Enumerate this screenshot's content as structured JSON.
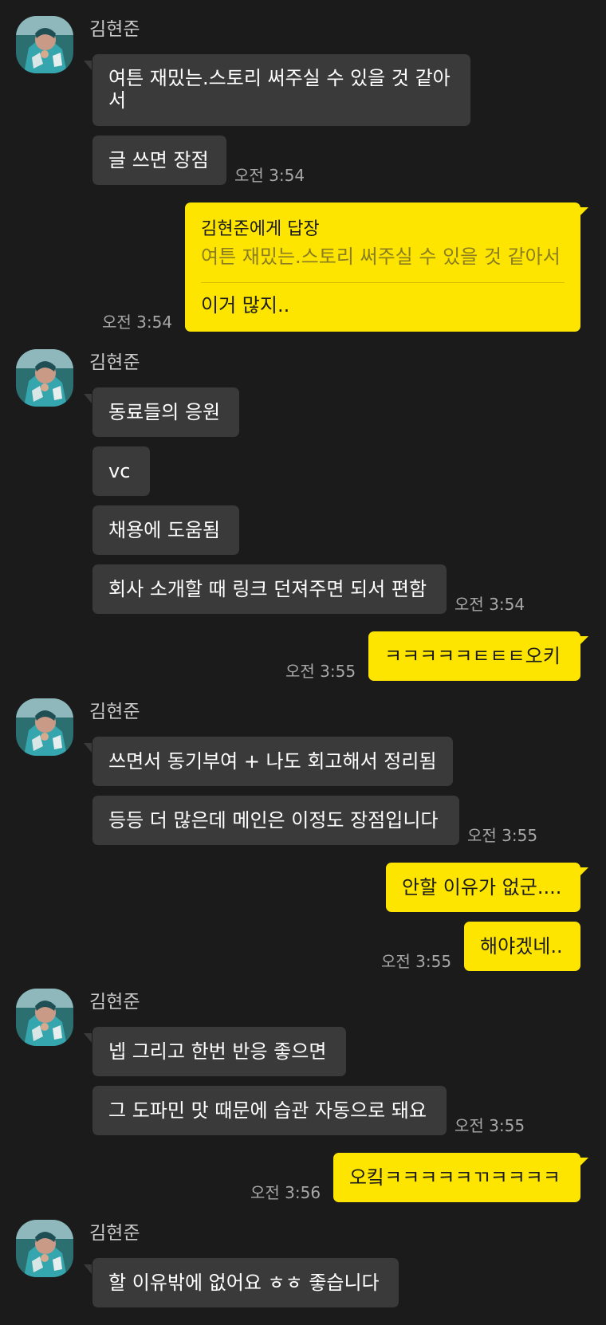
{
  "colors": {
    "background": "#1b1b1b",
    "incoming_bubble": "#3a3a3a",
    "outgoing_bubble": "#fee500",
    "timestamp": "#a8a8a8",
    "sender_name": "#c9c9c9"
  },
  "groups": [
    {
      "sender": "김현준",
      "messages": [
        {
          "text": "여튼 재밌는.스토리 써주실 수 있을 것 같아서"
        },
        {
          "text": "글 쓰면 장점",
          "time": "오전 3:54"
        }
      ]
    },
    {
      "mine": true,
      "reply": {
        "to": "김현준에게 답장",
        "quote": "여튼 재밌는.스토리 써주실 수 있을 것 같아서",
        "text": "이거 많지..",
        "time": "오전 3:54"
      }
    },
    {
      "sender": "김현준",
      "messages": [
        {
          "text": "동료들의 응원"
        },
        {
          "text": "vc"
        },
        {
          "text": "채용에 도움됨"
        },
        {
          "text": "회사 소개할 때 링크 던져주면 되서 편함",
          "time": "오전 3:54"
        }
      ]
    },
    {
      "mine": true,
      "messages": [
        {
          "text": "ㅋㅋㅋㅋㅋㅌㅌㅌ오키",
          "time": "오전 3:55"
        }
      ]
    },
    {
      "sender": "김현준",
      "messages": [
        {
          "text": "쓰면서 동기부여 + 나도 회고해서 정리됨"
        },
        {
          "text": "등등 더 많은데 메인은 이정도 장점입니다",
          "time": "오전 3:55"
        }
      ]
    },
    {
      "mine": true,
      "messages": [
        {
          "text": "안할 이유가 없군...."
        },
        {
          "text": "해야겠네..",
          "time": "오전 3:55"
        }
      ]
    },
    {
      "sender": "김현준",
      "messages": [
        {
          "text": "넵 그리고 한번 반응 좋으면"
        },
        {
          "text": "그 도파민 맛 때문에 습관 자동으로 돼요",
          "time": "오전 3:55"
        }
      ]
    },
    {
      "mine": true,
      "messages": [
        {
          "text": "오킼ㅋㅋㅋㅋㅋㄲㅋㅋㅋㅋ",
          "time": "오전 3:56"
        }
      ]
    },
    {
      "sender": "김현준",
      "messages": [
        {
          "text": "할 이유밖에 없어요 ㅎㅎ 좋습니다"
        }
      ]
    }
  ]
}
